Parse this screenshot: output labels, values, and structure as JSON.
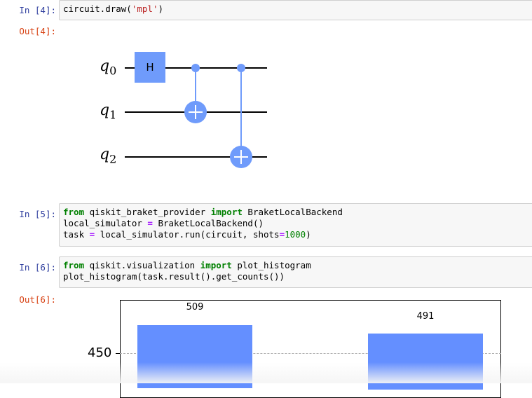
{
  "cells": [
    {
      "in_prompt": "In [4]:",
      "code": "circuit.draw('mpl')",
      "out_prompt": "Out[4]:"
    },
    {
      "in_prompt": "In [5]:",
      "lines": [
        "from qiskit_braket_provider import BraketLocalBackend",
        "local_simulator = BraketLocalBackend()",
        "task = local_simulator.run(circuit, shots=1000)"
      ]
    },
    {
      "in_prompt": "In [6]:",
      "lines": [
        "from qiskit.visualization import plot_histogram",
        "plot_histogram(task.result().get_counts())"
      ],
      "out_prompt": "Out[6]:"
    }
  ],
  "circuit": {
    "qubits": [
      "q",
      "q",
      "q"
    ],
    "qubit_indices": [
      "0",
      "1",
      "2"
    ],
    "gates": [
      {
        "type": "H",
        "label": "H",
        "qubit": 0
      },
      {
        "type": "CX",
        "control": 0,
        "target": 1
      },
      {
        "type": "CX",
        "control": 0,
        "target": 2
      }
    ],
    "gate_color": "#6f9bfb"
  },
  "chart_data": {
    "type": "bar",
    "values": [
      509,
      491
    ],
    "value_labels": [
      "509",
      "491"
    ],
    "yticks": [
      "450"
    ],
    "bar_color": "#648fff"
  }
}
